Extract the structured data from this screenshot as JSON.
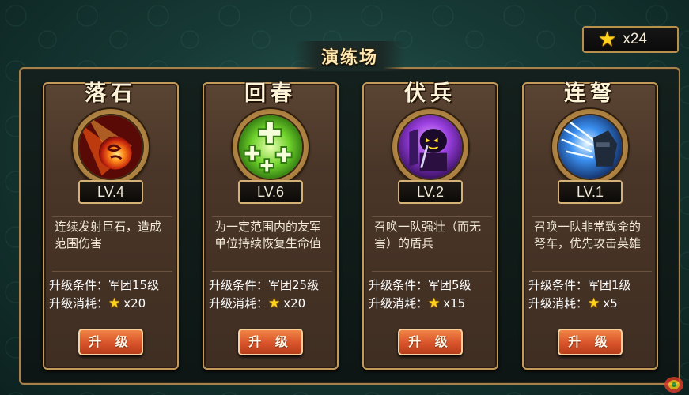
{
  "currency": {
    "icon": "star-icon",
    "amount": "x24"
  },
  "panel": {
    "title": "演练场"
  },
  "labels": {
    "upgrade_condition": "升级条件：",
    "upgrade_cost": "升级消耗："
  },
  "cards": [
    {
      "name": "落石",
      "icon": "meteor-icon",
      "level": "LV.4",
      "description": "连续发射巨石，造成范围伤害",
      "condition": "军团15级",
      "cost": "x20",
      "button": "升 级"
    },
    {
      "name": "回春",
      "icon": "heal-cross-icon",
      "level": "LV.6",
      "description": "为一定范围内的友军单位持续恢复生命值",
      "condition": "军团25级",
      "cost": "x20",
      "button": "升 级"
    },
    {
      "name": "伏兵",
      "icon": "ambush-shield-soldier-icon",
      "level": "LV.2",
      "description": "召唤一队强壮（而无害）的盾兵",
      "condition": "军团5级",
      "cost": "x15",
      "button": "升 级"
    },
    {
      "name": "连弩",
      "icon": "crossbow-icon",
      "level": "LV.1",
      "description": "召唤一队非常致命的弩车，优先攻击英雄",
      "condition": "军团1级",
      "cost": "x5",
      "button": "升 级"
    }
  ],
  "colors": {
    "accent_gold": "#c49a5a",
    "button_orange": "#d9532a",
    "star": "#ffd21f"
  }
}
